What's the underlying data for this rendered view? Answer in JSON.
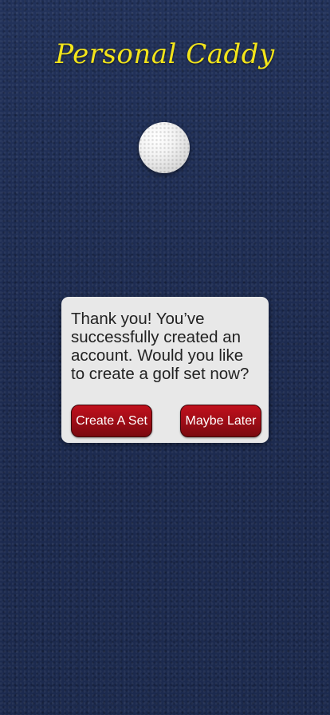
{
  "app": {
    "title": "Personal Caddy"
  },
  "dialog": {
    "message": "Thank you! You’ve successfully created an account. Would you like to create a golf set now?",
    "primary_button": "Create A Set",
    "secondary_button": "Maybe Later"
  },
  "colors": {
    "background": "#1f2e54",
    "title": "#f2e41a",
    "dialog_bg": "#e8e8e8",
    "button": "#a30d17"
  },
  "icons": {
    "logo": "golf-ball-icon"
  }
}
